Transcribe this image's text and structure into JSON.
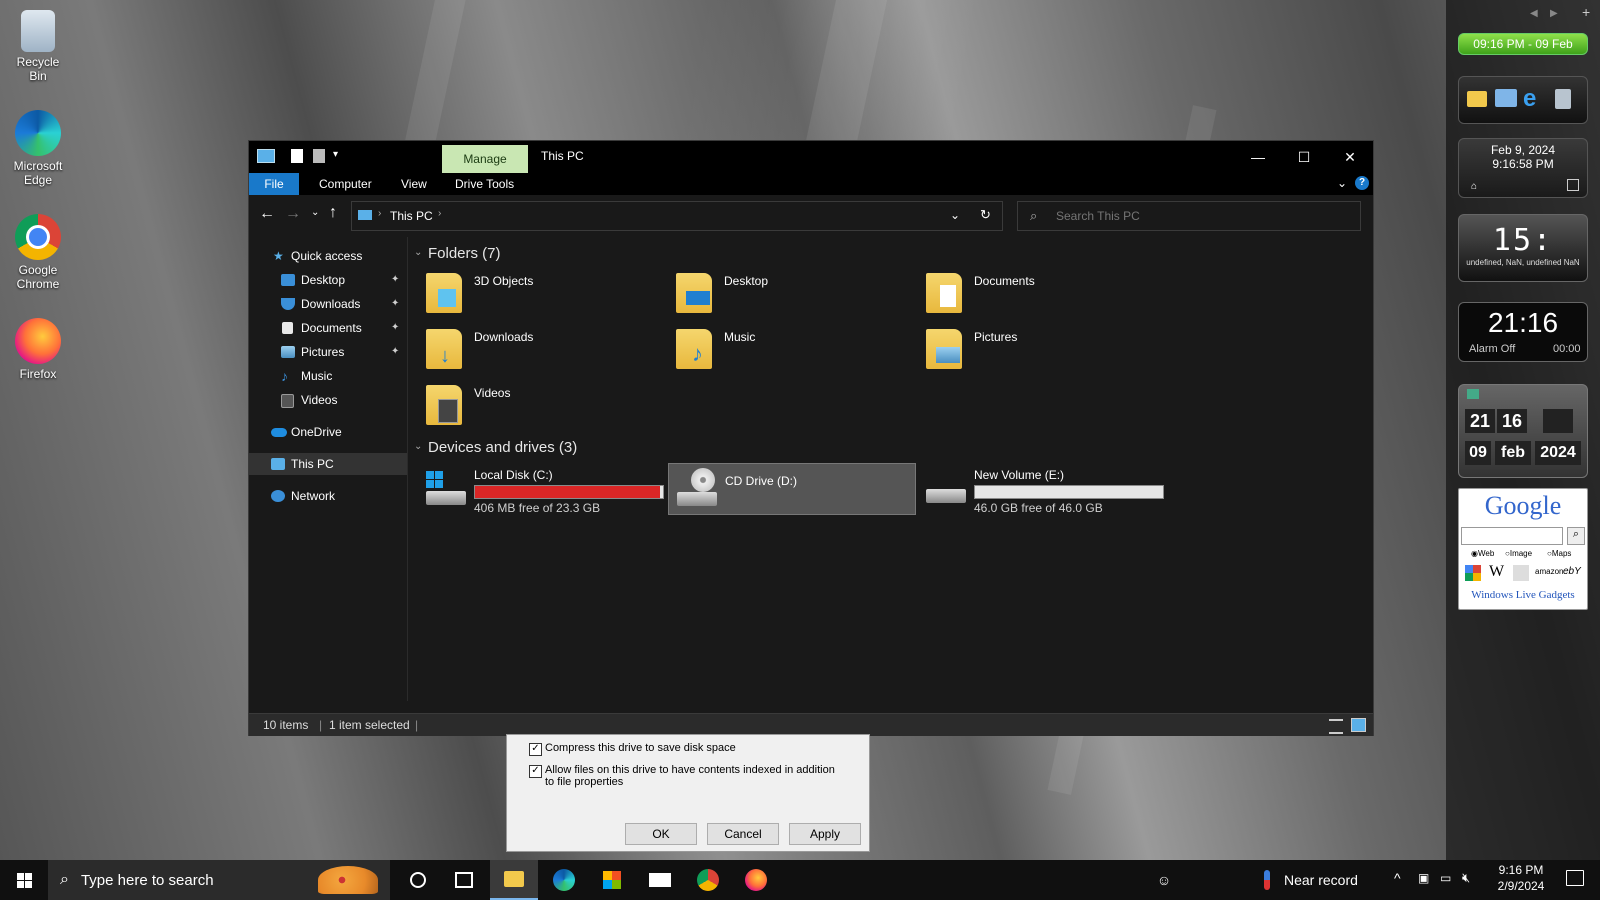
{
  "desktop": {
    "icons": [
      {
        "label": "Recycle Bin"
      },
      {
        "label": "Microsoft Edge"
      },
      {
        "label": "Google Chrome"
      },
      {
        "label": "Firefox"
      }
    ]
  },
  "gadgets": {
    "time_banner": "09:16 PM - 09 Feb",
    "calendar": {
      "date": "Feb 9, 2024",
      "time": "9:16:58 PM"
    },
    "digital_clock": {
      "time": "15:",
      "sub": "undefined, NaN, undefined NaN"
    },
    "alarm_clock": {
      "time": "21:16",
      "alarm": "Alarm Off",
      "countdown": "00:00"
    },
    "flip_clock": {
      "hour": "21",
      "minute": "16",
      "day": "09",
      "month": "feb",
      "year": "2024"
    },
    "google": {
      "logo": "Google",
      "options": [
        "Web",
        "Image",
        "Maps"
      ],
      "footer": "Windows Live Gadgets",
      "sites": [
        "W",
        "amazon",
        "ebY"
      ]
    }
  },
  "explorer": {
    "title": "This PC",
    "manage_tab": "Manage",
    "tabs": [
      "File",
      "Computer",
      "View",
      "Drive Tools"
    ],
    "address": "This PC",
    "search_placeholder": "Search This PC",
    "nav": {
      "quick_access": "Quick access",
      "items": [
        "Desktop",
        "Downloads",
        "Documents",
        "Pictures",
        "Music",
        "Videos"
      ],
      "onedrive": "OneDrive",
      "this_pc": "This PC",
      "network": "Network"
    },
    "folders_header": "Folders (7)",
    "folders": [
      "3D Objects",
      "Desktop",
      "Documents",
      "Downloads",
      "Music",
      "Pictures",
      "Videos"
    ],
    "drives_header": "Devices and drives (3)",
    "drives": [
      {
        "name": "Local Disk (C:)",
        "free": "406 MB free of 23.3 GB",
        "used_fraction": 0.983,
        "color": "#da2626"
      },
      {
        "name": "CD Drive (D:)",
        "free": "",
        "used_fraction": 0,
        "color": "#26a0da"
      },
      {
        "name": "New Volume (E:)",
        "free": "46.0 GB free of 46.0 GB",
        "used_fraction": 0.0,
        "color": "#26a0da"
      }
    ],
    "status": {
      "items": "10 items",
      "selected": "1 item selected"
    }
  },
  "properties_dialog": {
    "compress": "Compress this drive to save disk space",
    "index": "Allow files on this drive to have contents indexed in addition to file properties",
    "ok": "OK",
    "cancel": "Cancel",
    "apply": "Apply"
  },
  "taskbar": {
    "search_placeholder": "Type here to search",
    "weather": "Near record",
    "time": "9:16 PM",
    "date": "2/9/2024"
  }
}
